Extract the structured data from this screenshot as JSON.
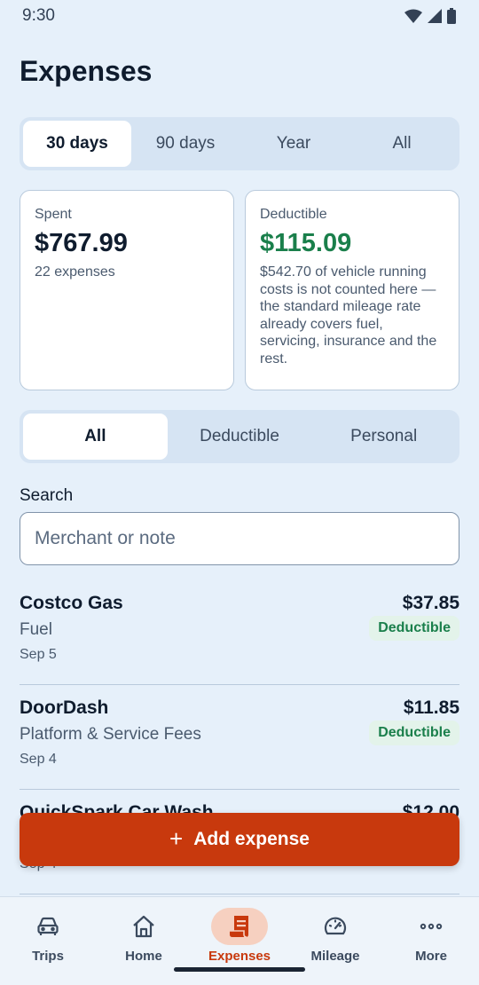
{
  "status_bar": {
    "time": "9:30"
  },
  "page": {
    "title": "Expenses"
  },
  "period_tabs": [
    {
      "label": "30 days",
      "active": true
    },
    {
      "label": "90 days",
      "active": false
    },
    {
      "label": "Year",
      "active": false
    },
    {
      "label": "All",
      "active": false
    }
  ],
  "summary": {
    "spent": {
      "label": "Spent",
      "amount": "$767.99",
      "sub": "22 expenses"
    },
    "deductible": {
      "label": "Deductible",
      "amount": "$115.09",
      "note": "$542.70 of vehicle running costs is not counted here — the standard mileage rate already covers fuel, servicing, insurance and the rest."
    }
  },
  "filter_tabs": [
    {
      "label": "All",
      "active": true
    },
    {
      "label": "Deductible",
      "active": false
    },
    {
      "label": "Personal",
      "active": false
    }
  ],
  "search": {
    "label": "Search",
    "placeholder": "Merchant or note",
    "value": ""
  },
  "expenses": [
    {
      "merchant": "Costco Gas",
      "category": "Fuel",
      "date": "Sep 5",
      "amount": "$37.85",
      "badge": "Deductible"
    },
    {
      "merchant": "DoorDash",
      "category": "Platform & Service Fees",
      "date": "Sep 4",
      "amount": "$11.85",
      "badge": "Deductible"
    },
    {
      "merchant": "QuickSpark Car Wash",
      "category": "",
      "date": "Sep 4",
      "amount": "$12.00",
      "badge": ""
    }
  ],
  "fab": {
    "label": "Add expense"
  },
  "bottom_nav": [
    {
      "label": "Trips",
      "icon": "car-icon",
      "active": false
    },
    {
      "label": "Home",
      "icon": "home-icon",
      "active": false
    },
    {
      "label": "Expenses",
      "icon": "receipt-icon",
      "active": true
    },
    {
      "label": "Mileage",
      "icon": "speedometer-icon",
      "active": false
    },
    {
      "label": "More",
      "icon": "more-dots-icon",
      "active": false
    }
  ],
  "colors": {
    "accent": "#c8390d",
    "deductible_green": "#1a7f4b",
    "background": "#e6f0fa"
  }
}
